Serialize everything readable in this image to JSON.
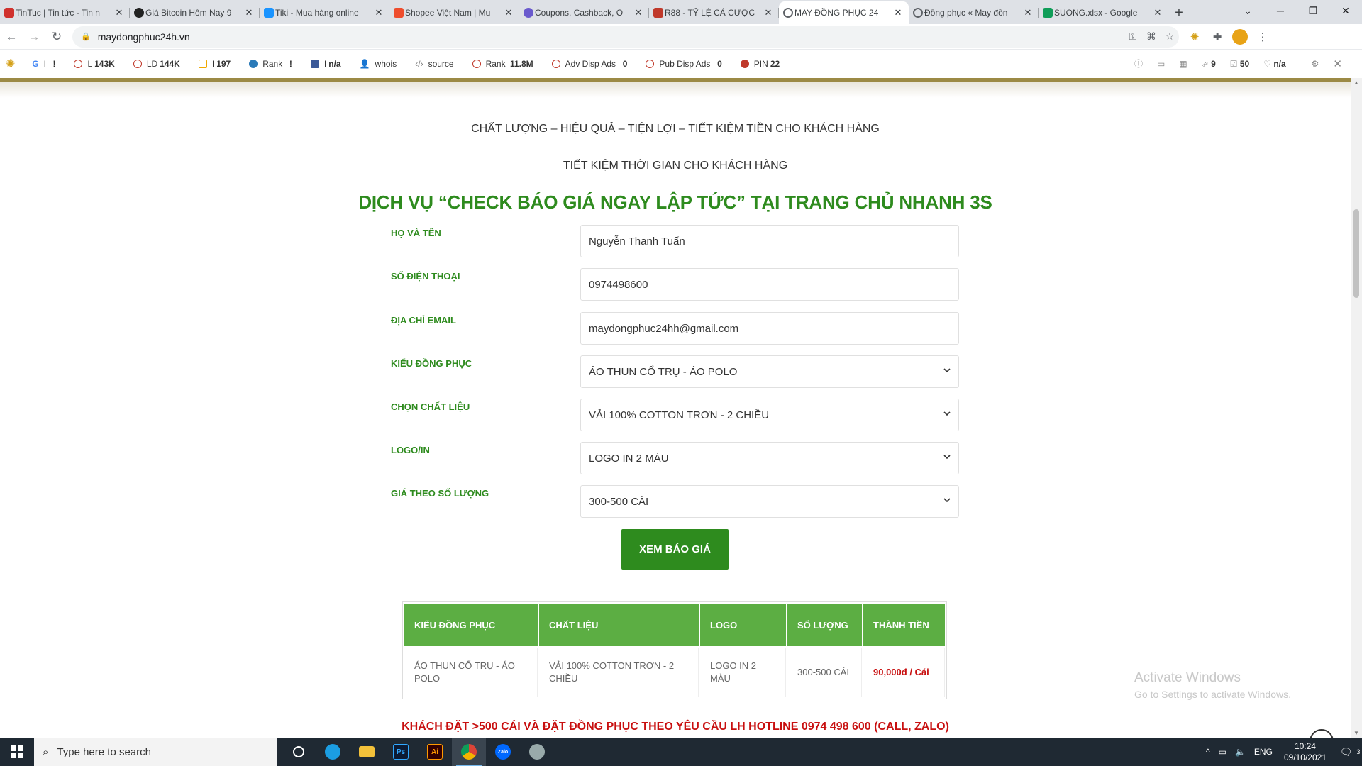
{
  "browser": {
    "tabs": [
      {
        "title": "TinTuc | Tin tức - Tin n",
        "icon_color": "#d0312d",
        "active": false
      },
      {
        "title": "Giá Bitcoin Hôm Nay 9",
        "icon_color": "#222222",
        "active": false
      },
      {
        "title": "Tiki - Mua hàng online",
        "icon_color": "#1a94ff",
        "active": false
      },
      {
        "title": "Shopee Việt Nam | Mu",
        "icon_color": "#ee4d2d",
        "active": false
      },
      {
        "title": "Coupons, Cashback, O",
        "icon_color": "#6a5acd",
        "active": false
      },
      {
        "title": "R88 - TỶ LỆ CÁ CƯỢC",
        "icon_color": "#c0392b",
        "active": false
      },
      {
        "title": "MAY ĐỒNG PHỤC 24",
        "icon_color": "#5f6368",
        "active": true
      },
      {
        "title": "Đồng phục « May đồn",
        "icon_color": "#5f6368",
        "active": false
      },
      {
        "title": "SUONG.xlsx - Google",
        "icon_color": "#0f9d58",
        "active": false
      }
    ],
    "url": "maydongphuc24h.vn"
  },
  "extension_bar": {
    "items": [
      {
        "label": "G",
        "value": "!",
        "extra": "!"
      },
      {
        "label": "L",
        "value": "143K"
      },
      {
        "label": "LD",
        "value": "144K"
      },
      {
        "label": "I",
        "value": "197"
      },
      {
        "label": "Rank",
        "value": "!"
      },
      {
        "label": "I",
        "value": "n/a"
      },
      {
        "label": "whois",
        "value": ""
      },
      {
        "label": "source",
        "value": ""
      },
      {
        "label": "Rank",
        "value": "11.8M"
      },
      {
        "label": "Adv Disp Ads",
        "value": "0"
      },
      {
        "label": "Pub Disp Ads",
        "value": "0"
      },
      {
        "label": "PIN",
        "value": "22"
      }
    ],
    "right": {
      "links": "9",
      "checked": "50",
      "likes": "n/a"
    }
  },
  "page": {
    "slogan1": "CHẤT LƯỢNG – HIỆU QUẢ – TIỆN LỢI – TIẾT KIỆM TIỀN CHO KHÁCH HÀNG",
    "slogan2": "TIẾT KIỆM THỜI GIAN CHO KHÁCH HÀNG",
    "headline": "DỊCH VỤ “CHECK BÁO GIÁ NGAY LẬP TỨC” TẠI TRANG CHỦ NHANH 3S",
    "form": {
      "name_label": "HỌ VÀ TÊN",
      "name_value": "Nguyễn Thanh Tuấn",
      "phone_label": "SỐ ĐIỆN THOẠI",
      "phone_value": "0974498600",
      "email_label": "ĐỊA CHỈ EMAIL",
      "email_value": "maydongphuc24hh@gmail.com",
      "style_label": "KIỂU ĐỒNG PHỤC",
      "style_value": "ÁO THUN CỔ TRỤ - ÁO POLO",
      "material_label": "CHỌN CHẤT LIỆU",
      "material_value": "VẢI 100% COTTON TRƠN - 2 CHIỀU",
      "logo_label": "LOGO/IN",
      "logo_value": "LOGO IN 2 MÀU",
      "qty_label": "GIÁ THEO SỐ LƯỢNG",
      "qty_value": "300-500 CÁI",
      "submit_label": "XEM BÁO GIÁ"
    },
    "result_table": {
      "headers": [
        "KIỂU ĐỒNG PHỤC",
        "CHẤT LIỆU",
        "LOGO",
        "SỐ LƯỢNG",
        "THÀNH TIỀN"
      ],
      "row": [
        "ÁO THUN CỔ TRỤ - ÁO POLO",
        "VẢI 100% COTTON TRƠN - 2 CHIỀU",
        "LOGO IN 2 MÀU",
        "300-500 CÁI",
        "90,000đ / Cái"
      ]
    },
    "hotline": "KHÁCH ĐẶT >500 CÁI VÀ ĐẶT ĐỒNG PHỤC THEO YÊU CẦU LH HOTLINE 0974 498 600 (CALL, ZALO)",
    "accent_color": "#2e8b1e",
    "price_color": "#c81010"
  },
  "watermark": {
    "line1": "Activate Windows",
    "line2": "Go to Settings to activate Windows."
  },
  "taskbar": {
    "search_placeholder": "Type here to search",
    "apps": [
      "Ps",
      "Ai",
      "Zalo"
    ],
    "lang": "ENG",
    "time": "10:24",
    "date": "09/10/2021",
    "notifications": "3"
  }
}
